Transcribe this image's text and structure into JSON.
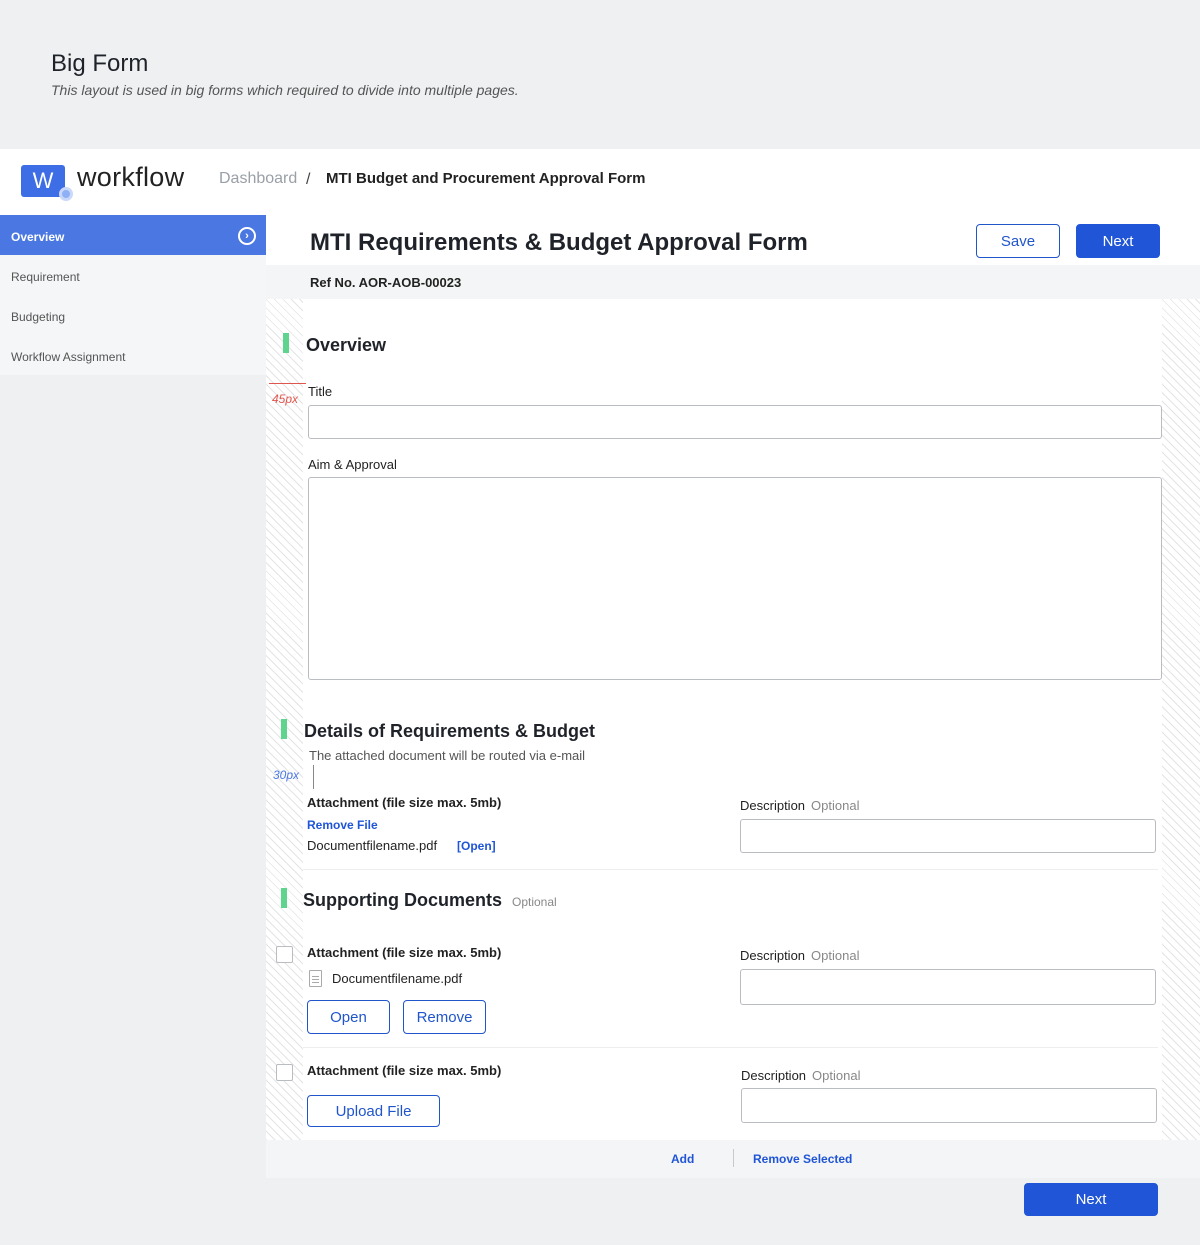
{
  "doc": {
    "title": "Big Form",
    "subtitle": "This layout is used in big forms which required to divide into multiple pages."
  },
  "app": {
    "logo_letter": "W",
    "logo_text": "workflow",
    "breadcrumb": {
      "root": "Dashboard",
      "separator": "/",
      "current": "MTI Budget and Procurement Approval Form"
    }
  },
  "sidebar": {
    "items": [
      {
        "label": "Overview",
        "active": true
      },
      {
        "label": "Requirement",
        "active": false
      },
      {
        "label": "Budgeting",
        "active": false
      },
      {
        "label": "Workflow Assignment",
        "active": false
      }
    ]
  },
  "form": {
    "title": "MTI Requirements & Budget Approval Form",
    "save_label": "Save",
    "next_label": "Next",
    "ref_no": "Ref No. AOR-AOB-00023"
  },
  "overview": {
    "heading": "Overview",
    "title_label": "Title",
    "title_value": "",
    "aim_label": "Aim & Approval",
    "aim_value": ""
  },
  "details": {
    "heading": "Details of Requirements & Budget",
    "note": "The attached document will be routed via e-mail",
    "attachment_label": "Attachment (file size max. 5mb)",
    "remove_file": "Remove File",
    "filename": "Documentfilename.pdf",
    "open_link": "[Open]",
    "description_label": "Description",
    "optional": "Optional",
    "description_value": ""
  },
  "supporting": {
    "heading": "Supporting Documents",
    "optional": "Optional",
    "rows": [
      {
        "attachment_label": "Attachment (file size max. 5mb)",
        "filename": "Documentfilename.pdf",
        "open_label": "Open",
        "remove_label": "Remove",
        "description_label": "Description",
        "optional": "Optional",
        "description_value": ""
      },
      {
        "attachment_label": "Attachment (file size max. 5mb)",
        "upload_label": "Upload File",
        "description_label": "Description",
        "optional": "Optional",
        "description_value": ""
      }
    ],
    "add_label": "Add",
    "remove_selected_label": "Remove Selected"
  },
  "annotations": {
    "spacing_45": "45px",
    "spacing_30": "30px"
  },
  "bottom": {
    "next_label": "Next"
  },
  "colors": {
    "primary": "#1f55d6",
    "sidebar_active": "#4a77e1",
    "section_marker": "#5ed48e",
    "annotation_red": "#e0564f",
    "annotation_blue": "#4a77e1"
  }
}
